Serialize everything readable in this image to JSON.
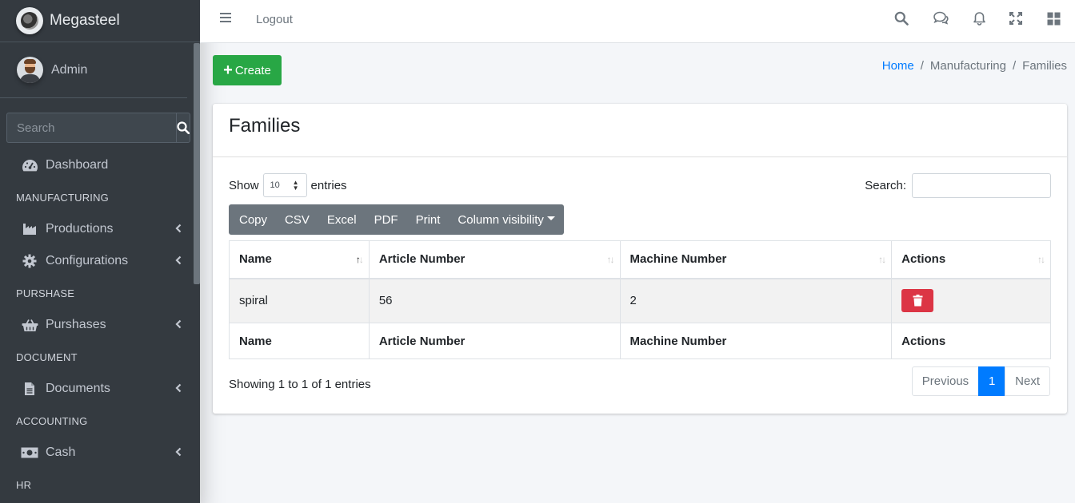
{
  "brand": {
    "name": "Megasteel"
  },
  "user": {
    "name": "Admin"
  },
  "sidebar": {
    "search_placeholder": "Search",
    "items": [
      {
        "type": "item",
        "label": "Dashboard",
        "icon": "dashboard-gauge-icon"
      },
      {
        "type": "header",
        "label": "MANUFACTURING"
      },
      {
        "type": "item",
        "label": "Productions",
        "icon": "industry-icon",
        "has_children": true
      },
      {
        "type": "item",
        "label": "Configurations",
        "icon": "gear-icon",
        "has_children": true
      },
      {
        "type": "header",
        "label": "PURSHASE"
      },
      {
        "type": "item",
        "label": "Purshases",
        "icon": "basket-icon",
        "has_children": true
      },
      {
        "type": "header",
        "label": "DOCUMENT"
      },
      {
        "type": "item",
        "label": "Documents",
        "icon": "file-icon",
        "has_children": true
      },
      {
        "type": "header",
        "label": "ACCOUNTING"
      },
      {
        "type": "item",
        "label": "Cash",
        "icon": "money-bill-icon",
        "has_children": true
      },
      {
        "type": "header",
        "label": "HR"
      }
    ]
  },
  "topbar": {
    "logout_label": "Logout",
    "icons": [
      "search-icon",
      "comments-icon",
      "bell-icon",
      "expand-icon",
      "grid-icon"
    ]
  },
  "toolbar": {
    "create_label": "Create"
  },
  "breadcrumb": {
    "home": "Home",
    "section": "Manufacturing",
    "current": "Families"
  },
  "card": {
    "title": "Families",
    "show_label": "Show",
    "entries_label": "entries",
    "page_length": "10",
    "search_label": "Search:",
    "buttons": [
      "Copy",
      "CSV",
      "Excel",
      "PDF",
      "Print",
      "Column visibility"
    ],
    "columns": [
      "Name",
      "Article Number",
      "Machine Number",
      "Actions"
    ],
    "rows": [
      {
        "name": "spiral",
        "article_number": "56",
        "machine_number": "2"
      }
    ],
    "info": "Showing 1 to 1 of 1 entries",
    "pagination": {
      "previous": "Previous",
      "current": "1",
      "next": "Next"
    }
  },
  "colors": {
    "sidebar_bg": "#343a40",
    "primary": "#007bff",
    "success": "#28a745",
    "danger": "#dc3545",
    "secondary": "#6c757d"
  }
}
